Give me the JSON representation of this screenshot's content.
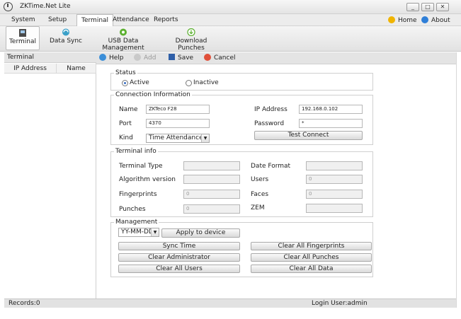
{
  "window": {
    "title": "ZKTime.Net Lite",
    "controls": {
      "minimize": "_",
      "maximize": "□",
      "close": "✕"
    }
  },
  "menubar": {
    "items": [
      "System",
      "Setup",
      "Terminal",
      "Attendance",
      "Reports"
    ],
    "active": "Terminal",
    "home_label": "Home",
    "about_label": "About"
  },
  "toolbar": {
    "items": [
      {
        "label": "Terminal",
        "icon": "terminal-icon"
      },
      {
        "label": "Data Sync",
        "icon": "data-sync-icon"
      },
      {
        "label": "USB Data Management",
        "icon": "usb-icon"
      },
      {
        "label": "Download Punches",
        "icon": "download-icon"
      }
    ]
  },
  "left_panel": {
    "title": "Terminal",
    "columns": [
      "IP Address",
      "Name"
    ]
  },
  "actions": {
    "help": "Help",
    "add": "Add",
    "save": "Save",
    "cancel": "Cancel"
  },
  "status": {
    "legend": "Status",
    "active": "Active",
    "inactive": "Inactive",
    "selected": "Active"
  },
  "connection": {
    "legend": "Connection Information",
    "name_label": "Name",
    "name_value": "ZKTeco F28",
    "port_label": "Port",
    "port_value": "4370",
    "kind_label": "Kind",
    "kind_value": "Time Attendance",
    "ip_label": "IP Address",
    "ip_value": "192.168.0.102",
    "password_label": "Password",
    "password_value": "*",
    "test_connect": "Test Connect"
  },
  "terminal_info": {
    "legend": "Terminal info",
    "terminal_type": "Terminal Type",
    "algorithm_version": "Algorithm version",
    "fingerprints": "Fingerprints",
    "fingerprints_value": "0",
    "punches": "Punches",
    "punches_value": "0",
    "date_format": "Date Format",
    "users": "Users",
    "users_value": "0",
    "faces": "Faces",
    "faces_value": "0",
    "zem": "ZEM"
  },
  "management": {
    "legend": "Management",
    "date_format_value": "YY-MM-DD",
    "apply": "Apply to device",
    "sync_time": "Sync Time",
    "clear_admin": "Clear Administrator",
    "clear_users": "Clear All Users",
    "clear_fingerprints": "Clear All Fingerprints",
    "clear_punches": "Clear All Punches",
    "clear_data": "Clear All Data"
  },
  "statusbar": {
    "records": "Records:0",
    "login": "Login User:admin"
  },
  "colors": {
    "accent": "#3a6fc4",
    "home_icon": "#f0b400",
    "about_icon": "#2f7fd8",
    "save_icon": "#2f5fa8",
    "cancel_icon": "#e0503a",
    "help_icon": "#3b8ed8"
  }
}
